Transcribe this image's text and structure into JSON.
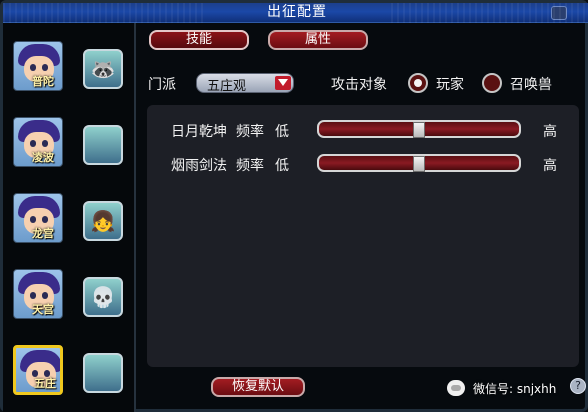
{
  "window": {
    "title": "出征配置"
  },
  "characters": [
    {
      "name": "普陀",
      "pet_icon": "raccoon-pet-icon",
      "pet_glyph": "🦝",
      "selected": false
    },
    {
      "name": "凌波",
      "pet_icon": "empty-pet-slot-icon",
      "pet_glyph": "",
      "selected": false
    },
    {
      "name": "龙宫",
      "pet_icon": "red-hair-pet-icon",
      "pet_glyph": "👧",
      "selected": false
    },
    {
      "name": "天宫",
      "pet_icon": "skull-pet-icon",
      "pet_glyph": "💀",
      "selected": false
    },
    {
      "name": "五庄",
      "pet_icon": "empty-pet-slot-icon",
      "pet_glyph": "",
      "selected": true
    }
  ],
  "tabs": [
    {
      "label": "技能",
      "active": true
    },
    {
      "label": "属性",
      "active": false
    }
  ],
  "faction": {
    "label": "门派",
    "value": "五庄观"
  },
  "target": {
    "label": "攻击对象",
    "options": [
      {
        "label": "玩家",
        "selected": true
      },
      {
        "label": "召唤兽",
        "selected": false
      }
    ]
  },
  "skills": [
    {
      "name": "日月乾坤",
      "freq_label": "频率",
      "low_label": "低",
      "high_label": "高",
      "level": 0.5
    },
    {
      "name": "烟雨剑法",
      "freq_label": "频率",
      "low_label": "低",
      "high_label": "高",
      "level": 0.5
    }
  ],
  "buttons": {
    "reset": "恢复默认"
  },
  "watermark": "微信号: snjxhh",
  "help": "?",
  "colors": {
    "accent": "#a31c22",
    "title_bar": "#1b48a8",
    "selected_border": "#f0c81e"
  }
}
